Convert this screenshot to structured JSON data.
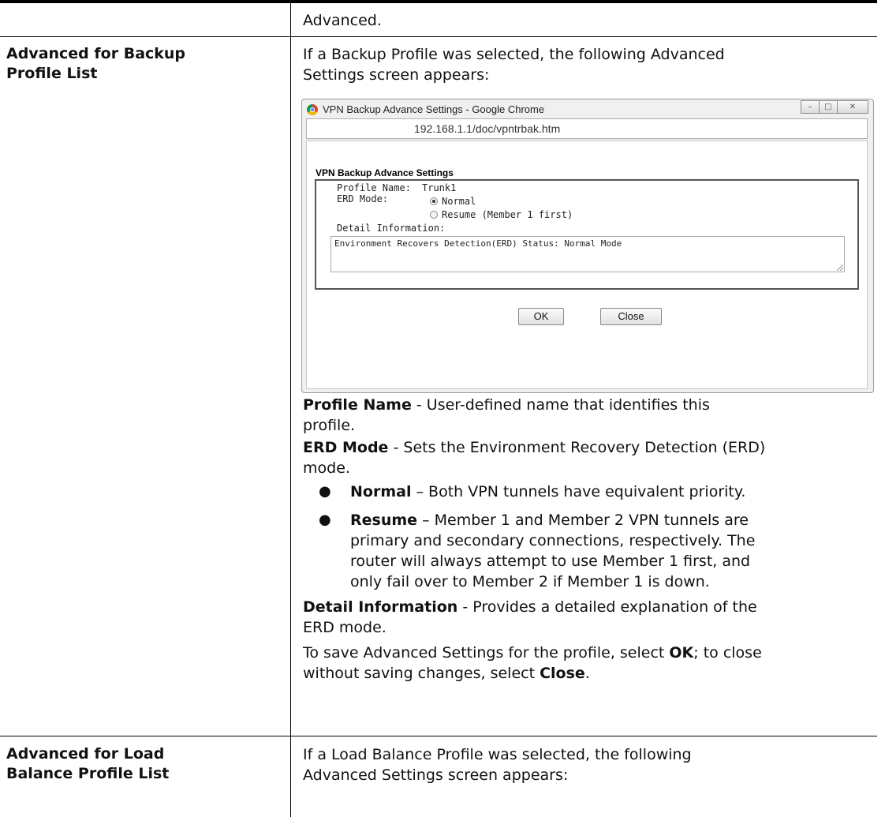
{
  "rows": [
    {
      "label": "",
      "text": "Advanced."
    },
    {
      "label_lines": [
        "Advanced for Backup",
        "Profile List"
      ],
      "intro_lines": [
        "If a Backup Profile was selected, the following Advanced",
        "Settings screen appears:"
      ]
    },
    {
      "label_lines": [
        "Advanced for Load",
        "Balance Profile List"
      ],
      "intro_lines": [
        "If a Load Balance Profile was selected, the following",
        "Advanced Settings screen appears:"
      ]
    }
  ],
  "window": {
    "title": "VPN Backup Advance Settings - Google Chrome",
    "controls": [
      "–",
      "□",
      "✕"
    ],
    "url": "192.168.1.1/doc/vpntrbak.htm",
    "dialog_title": "VPN Backup Advance Settings",
    "profile_name_label": "Profile Name:",
    "profile_name_value": "Trunk1",
    "erd_mode_label": "ERD Mode:",
    "erd_options": [
      {
        "label": "Normal",
        "selected": true
      },
      {
        "label": "Resume (Member 1 first)",
        "selected": false
      }
    ],
    "detail_label": "Detail Information:",
    "detail_value": "Environment Recovers Detection(ERD) Status: Normal Mode",
    "ok_button": "OK",
    "close_button": "Close"
  },
  "descriptions": {
    "profile_name": {
      "term": "Profile Name",
      "lines": [
        " - User-defined name that identifies this",
        "profile."
      ]
    },
    "erd_mode": {
      "term": "ERD Mode",
      "lines": [
        " - Sets the Environment Recovery Detection (ERD)",
        "mode."
      ]
    },
    "bullets": [
      {
        "term": "Normal",
        "lines": [
          " – Both VPN tunnels have equivalent priority."
        ]
      },
      {
        "term": "Resume",
        "lines": [
          " – Member 1 and Member 2 VPN tunnels are",
          "primary and secondary connections, respectively. The",
          "router will always attempt to use Member 1 first, and",
          "only fail over to Member 2 if Member 1 is down."
        ]
      }
    ],
    "bullet_glyph": "●",
    "detail_info": {
      "term": "Detail Information",
      "lines": [
        " - Provides a detailed explanation of the",
        "ERD mode."
      ]
    },
    "save_note": {
      "a": "To save Advanced Settings for the profile, select ",
      "ok": "OK",
      "b": "; to close",
      "c": "without saving changes, select ",
      "close": "Close",
      "d": "."
    }
  }
}
